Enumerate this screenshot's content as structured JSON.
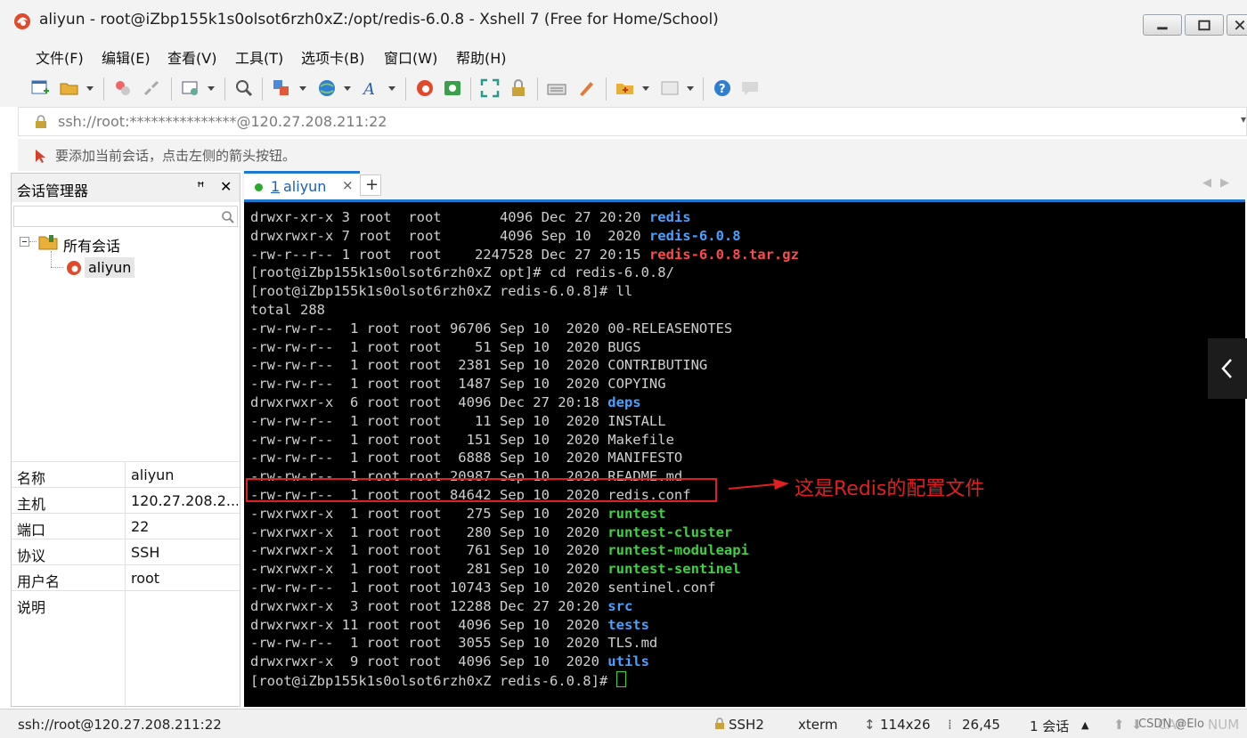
{
  "window": {
    "title": "aliyun - root@iZbp155k1s0olsot6rzh0xZ:/opt/redis-6.0.8 - Xshell 7 (Free for Home/School)"
  },
  "menu": [
    "文件(F)",
    "编辑(E)",
    "查看(V)",
    "工具(T)",
    "选项卡(B)",
    "窗口(W)",
    "帮助(H)"
  ],
  "address": "ssh://root:***************@120.27.208.211:22",
  "hint": "要添加当前会话，点击左侧的箭头按钮。",
  "session_manager": {
    "title": "会话管理器",
    "pin": "ꟸ",
    "close": "✕",
    "tree_root": "所有会话",
    "tree_child": "aliyun",
    "properties": [
      {
        "key": "名称",
        "value": "aliyun"
      },
      {
        "key": "主机",
        "value": "120.27.208.2..."
      },
      {
        "key": "端口",
        "value": "22"
      },
      {
        "key": "协议",
        "value": "SSH"
      },
      {
        "key": "用户名",
        "value": "root"
      },
      {
        "key": "说明",
        "value": ""
      }
    ]
  },
  "tab": {
    "number": "1",
    "label": "aliyun",
    "close": "×",
    "add": "+"
  },
  "terminal": {
    "lines": [
      [
        [
          "drwxr-xr-x 3 root  root       4096 Dec 27 20:20 ",
          ""
        ],
        [
          "redis",
          "blue"
        ]
      ],
      [
        [
          "drwxrwxr-x 7 root  root       4096 Sep 10  2020 ",
          ""
        ],
        [
          "redis-6.0.8",
          "blue"
        ]
      ],
      [
        [
          "-rw-r--r-- 1 root  root    2247528 Dec 27 20:15 ",
          ""
        ],
        [
          "redis-6.0.8.tar.gz",
          "red"
        ]
      ],
      [
        [
          "[root@iZbp155k1s0olsot6rzh0xZ opt]# cd redis-6.0.8/",
          ""
        ]
      ],
      [
        [
          "[root@iZbp155k1s0olsot6rzh0xZ redis-6.0.8]# ll",
          ""
        ]
      ],
      [
        [
          "total 288",
          ""
        ]
      ],
      [
        [
          "-rw-rw-r--  1 root root 96706 Sep 10  2020 00-RELEASENOTES",
          ""
        ]
      ],
      [
        [
          "-rw-rw-r--  1 root root    51 Sep 10  2020 BUGS",
          ""
        ]
      ],
      [
        [
          "-rw-rw-r--  1 root root  2381 Sep 10  2020 CONTRIBUTING",
          ""
        ]
      ],
      [
        [
          "-rw-rw-r--  1 root root  1487 Sep 10  2020 COPYING",
          ""
        ]
      ],
      [
        [
          "drwxrwxr-x  6 root root  4096 Dec 27 20:18 ",
          ""
        ],
        [
          "deps",
          "blue"
        ]
      ],
      [
        [
          "-rw-rw-r--  1 root root    11 Sep 10  2020 INSTALL",
          ""
        ]
      ],
      [
        [
          "-rw-rw-r--  1 root root   151 Sep 10  2020 Makefile",
          ""
        ]
      ],
      [
        [
          "-rw-rw-r--  1 root root  6888 Sep 10  2020 MANIFESTO",
          ""
        ]
      ],
      [
        [
          "-rw-rw-r--  1 root root 20987 Sep 10  2020 README.md",
          ""
        ]
      ],
      [
        [
          "-rw-rw-r--  1 root root 84642 Sep 10  2020 redis.conf",
          ""
        ]
      ],
      [
        [
          "-rwxrwxr-x  1 root root   275 Sep 10  2020 ",
          ""
        ],
        [
          "runtest",
          "green"
        ]
      ],
      [
        [
          "-rwxrwxr-x  1 root root   280 Sep 10  2020 ",
          ""
        ],
        [
          "runtest-cluster",
          "green"
        ]
      ],
      [
        [
          "-rwxrwxr-x  1 root root   761 Sep 10  2020 ",
          ""
        ],
        [
          "runtest-moduleapi",
          "green"
        ]
      ],
      [
        [
          "-rwxrwxr-x  1 root root   281 Sep 10  2020 ",
          ""
        ],
        [
          "runtest-sentinel",
          "green"
        ]
      ],
      [
        [
          "-rw-rw-r--  1 root root 10743 Sep 10  2020 sentinel.conf",
          ""
        ]
      ],
      [
        [
          "drwxrwxr-x  3 root root 12288 Dec 27 20:20 ",
          ""
        ],
        [
          "src",
          "blue"
        ]
      ],
      [
        [
          "drwxrwxr-x 11 root root  4096 Sep 10  2020 ",
          ""
        ],
        [
          "tests",
          "blue"
        ]
      ],
      [
        [
          "-rw-rw-r--  1 root root  3055 Sep 10  2020 TLS.md",
          ""
        ]
      ],
      [
        [
          "drwxrwxr-x  9 root root  4096 Sep 10  2020 ",
          ""
        ],
        [
          "utils",
          "blue"
        ]
      ],
      [
        [
          "[root@iZbp155k1s0olsot6rzh0xZ redis-6.0.8]# ",
          ""
        ]
      ]
    ]
  },
  "annotation": "这是Redis的配置文件",
  "status": {
    "connection": "ssh://root@120.27.208.211:22",
    "protocol": "SSH2",
    "term": "xterm",
    "size": "114x26",
    "cursor": "26,45",
    "sessions": "1 会话",
    "caps": "CAP",
    "num": "NUM",
    "watermark": "CSDN @Elo"
  },
  "colors": {
    "accent": "#1e78d0",
    "term_bg": "#000000",
    "dir": "#4aa0ff",
    "archive": "#ff4a4a",
    "exec": "#3fd23f",
    "annotation": "#e02020"
  },
  "icons": [
    "xshell-logo-icon",
    "new-session-icon",
    "open-folder-icon",
    "reconnect-icon",
    "disconnect-icon",
    "properties-icon",
    "find-icon",
    "transfer-icon",
    "globe-icon",
    "font-icon",
    "xshell-icon",
    "xftp-icon",
    "fullscreen-icon",
    "lock-icon",
    "keyboard-icon",
    "script-icon",
    "add-folder-icon",
    "layout-icon",
    "help-icon",
    "chat-icon"
  ]
}
